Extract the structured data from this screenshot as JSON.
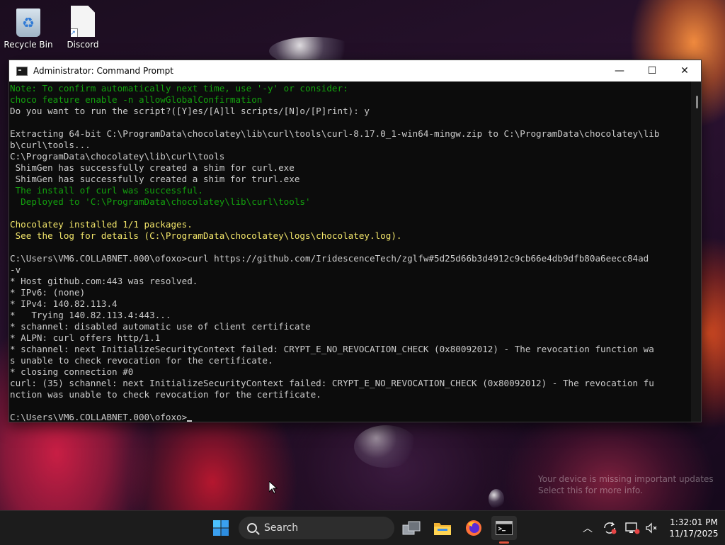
{
  "desktop": {
    "icons": [
      {
        "label": "Recycle Bin",
        "icon": "recycle-bin-icon"
      },
      {
        "label": "Discord",
        "icon": "discord-shortcut-icon"
      }
    ]
  },
  "window": {
    "title": "Administrator: Command Prompt",
    "controls": {
      "minimize": "—",
      "maximize": "☐",
      "close": "✕"
    },
    "lines": [
      {
        "text": "Note: To confirm automatically next time, use '-y' or consider:",
        "color": "green"
      },
      {
        "text": "choco feature enable -n allowGlobalConfirmation",
        "color": "green"
      },
      {
        "text": "Do you want to run the script?([Y]es/[A]ll scripts/[N]o/[P]rint): y",
        "color": "default"
      },
      {
        "text": "",
        "color": "default"
      },
      {
        "text": "Extracting 64-bit C:\\ProgramData\\chocolatey\\lib\\curl\\tools\\curl-8.17.0_1-win64-mingw.zip to C:\\ProgramData\\chocolatey\\lib",
        "color": "default"
      },
      {
        "text": "b\\curl\\tools...",
        "color": "default"
      },
      {
        "text": "C:\\ProgramData\\chocolatey\\lib\\curl\\tools",
        "color": "default"
      },
      {
        "text": " ShimGen has successfully created a shim for curl.exe",
        "color": "default"
      },
      {
        "text": " ShimGen has successfully created a shim for trurl.exe",
        "color": "default"
      },
      {
        "text": " The install of curl was successful.",
        "color": "green"
      },
      {
        "text": "  Deployed to 'C:\\ProgramData\\chocolatey\\lib\\curl\\tools'",
        "color": "green"
      },
      {
        "text": "",
        "color": "default"
      },
      {
        "text": "Chocolatey installed 1/1 packages.",
        "color": "yellow"
      },
      {
        "text": " See the log for details (C:\\ProgramData\\chocolatey\\logs\\chocolatey.log).",
        "color": "yellow"
      },
      {
        "text": "",
        "color": "default"
      },
      {
        "text": "C:\\Users\\VM6.COLLABNET.000\\ofoxo>curl https://github.com/IridescenceTech/zglfw#5d25d66b3d4912c9cb66e4db9dfb80a6eecc84ad",
        "color": "default"
      },
      {
        "text": "-v",
        "color": "default"
      },
      {
        "text": "* Host github.com:443 was resolved.",
        "color": "default"
      },
      {
        "text": "* IPv6: (none)",
        "color": "default"
      },
      {
        "text": "* IPv4: 140.82.113.4",
        "color": "default"
      },
      {
        "text": "*   Trying 140.82.113.4:443...",
        "color": "default"
      },
      {
        "text": "* schannel: disabled automatic use of client certificate",
        "color": "default"
      },
      {
        "text": "* ALPN: curl offers http/1.1",
        "color": "default"
      },
      {
        "text": "* schannel: next InitializeSecurityContext failed: CRYPT_E_NO_REVOCATION_CHECK (0x80092012) - The revocation function wa",
        "color": "default"
      },
      {
        "text": "s unable to check revocation for the certificate.",
        "color": "default"
      },
      {
        "text": "* closing connection #0",
        "color": "default"
      },
      {
        "text": "curl: (35) schannel: next InitializeSecurityContext failed: CRYPT_E_NO_REVOCATION_CHECK (0x80092012) - The revocation fu",
        "color": "default"
      },
      {
        "text": "nction was unable to check revocation for the certificate.",
        "color": "default"
      },
      {
        "text": "",
        "color": "default"
      }
    ],
    "prompt": "C:\\Users\\VM6.COLLABNET.000\\ofoxo>"
  },
  "watermark": {
    "line1": "Your device is missing important updates",
    "line2": "Select this for more info."
  },
  "taskbar": {
    "search_label": "Search",
    "apps": [
      "start-icon",
      "task-view-icon",
      "file-explorer-icon",
      "firefox-icon",
      "command-prompt-icon"
    ],
    "clock": {
      "time": "1:32:01 PM",
      "date": "11/17/2025"
    }
  },
  "colors": {
    "term_green": "#13a10e",
    "term_yellow": "#f2e56a",
    "term_default": "#cccccc",
    "term_bg": "#0c0c0c",
    "taskbar_bg": "#1c1c1c"
  }
}
